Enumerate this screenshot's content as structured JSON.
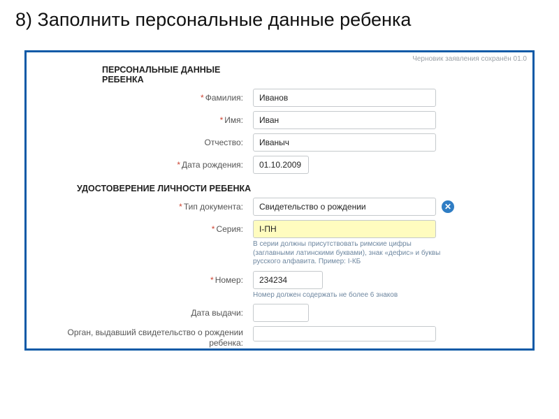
{
  "slide_title": "8) Заполнить персональные данные ребенка",
  "draft_note": "Черновик заявления сохранён 01.0",
  "sections": {
    "personal": "ПЕРСОНАЛЬНЫЕ ДАННЫЕ РЕБЕНКА",
    "identity": "УДОСТОВЕРЕНИЕ ЛИЧНОСТИ РЕБЕНКА"
  },
  "labels": {
    "lastname": "Фамилия:",
    "firstname": "Имя:",
    "patronymic": "Отчество:",
    "birthdate": "Дата рождения:",
    "doctype": "Тип документа:",
    "series": "Серия:",
    "number": "Номер:",
    "issued": "Дата выдачи:",
    "issuer": "Орган, выдавший свидетельство о рождении ребенка:"
  },
  "values": {
    "lastname": "Иванов",
    "firstname": "Иван",
    "patronymic": "Иваныч",
    "birthdate": "01.10.2009",
    "doctype": "Свидетельство о рождении",
    "series": "I-ПН",
    "number": "234234",
    "issued": "",
    "issuer": ""
  },
  "hints": {
    "series": "В серии должны присутствовать римские цифры (заглавными латинскими буквами), знак «дефис» и буквы русского алфавита. Пример: I-КБ",
    "number": "Номер должен содержать не более 6 знаков"
  },
  "clear_glyph": "✕"
}
